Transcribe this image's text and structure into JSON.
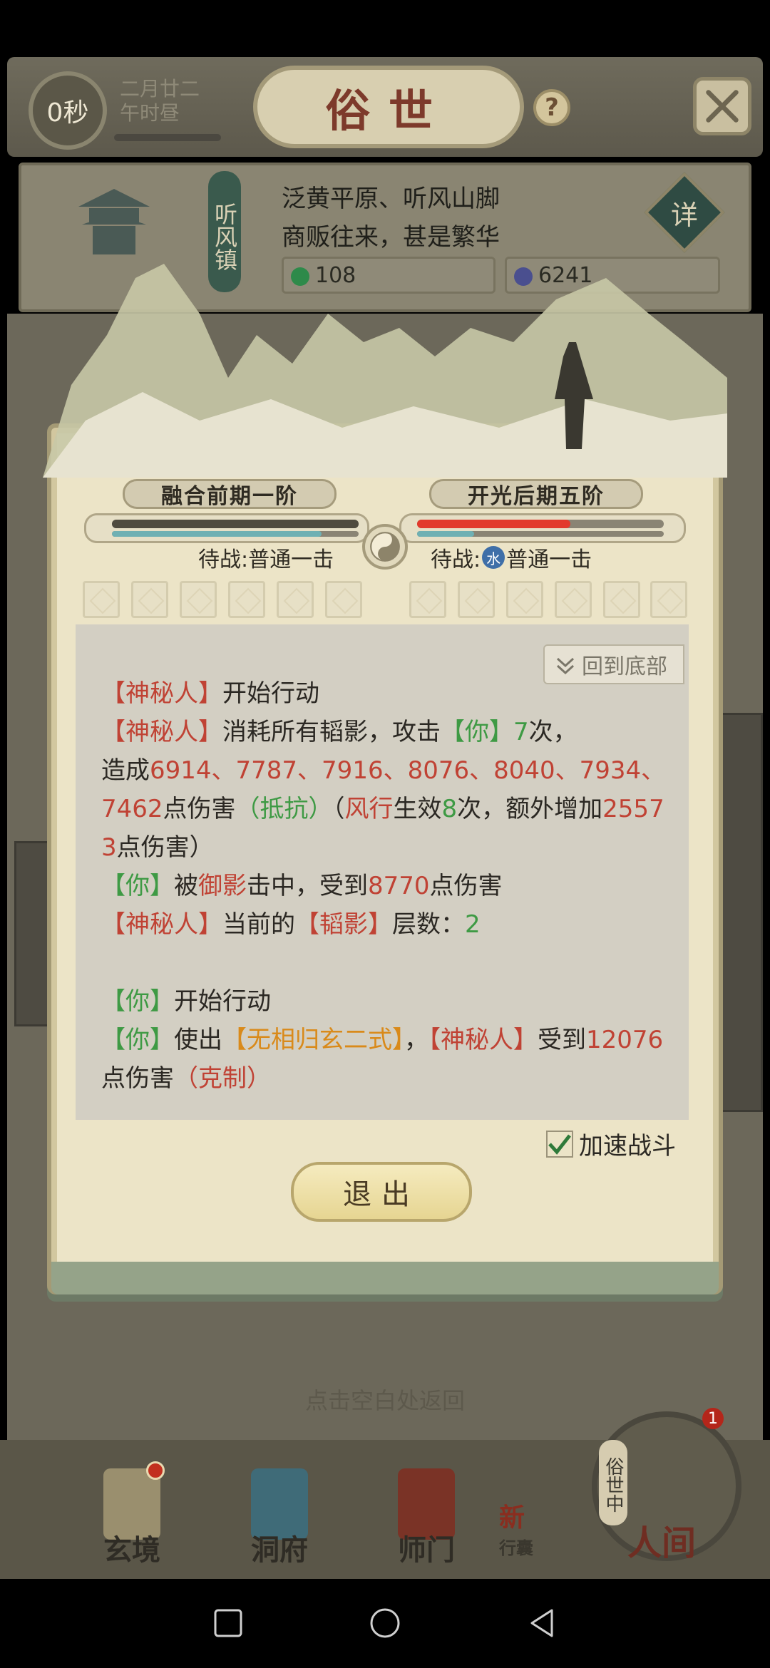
{
  "topbar": {
    "timer": "0秒",
    "date_line1": "二月廿二",
    "date_line2": "午时昼",
    "title": "俗世",
    "help": "?"
  },
  "location": {
    "town": "听风镇",
    "desc_line1": "泛黄平原、听风山脚",
    "desc_line2": "商贩往来，甚是繁华",
    "detail": "详",
    "resource1": "108",
    "resource2": "6241"
  },
  "battle": {
    "left_name": "融合前期一阶",
    "right_name": "开光后期五阶",
    "left_status": "待战:普通一击",
    "right_status_prefix": "待战:",
    "right_element": "水",
    "right_status_suffix": "普通一击",
    "left_hp": 1.0,
    "left_mp": 0.85,
    "right_hp": 0.62,
    "right_mp": 0.23,
    "colors": {
      "hp": "#e23a2c",
      "mp": "#6fb0b3",
      "hp_left": "#4f4b3f",
      "mp_left": "#6fb0b3"
    }
  },
  "log": {
    "back_to_bottom": "回到底部",
    "lines": {
      "l1_a": "【神秘人】",
      "l1_b": "开始行动",
      "l2_a": "【神秘人】",
      "l2_b": "消耗所有韬影，攻击",
      "l2_c": "【你】",
      "l2_d": "7",
      "l2_e": "次，",
      "l3_a": "造成",
      "l3_b": "6914、7787、7916、8076、8040、7934、7462",
      "l3_c": "点伤害",
      "l3_d": "（抵抗）",
      "l3_e": "（",
      "l3_f": "风行",
      "l3_g": "生效",
      "l3_h": "8",
      "l3_i": "次，额外增加",
      "l3_j": "25573",
      "l3_k": "点伤害）",
      "l4_a": "【你】",
      "l4_b": "被",
      "l4_c": "御影",
      "l4_d": "击中，受到",
      "l4_e": "8770",
      "l4_f": "点伤害",
      "l5_a": "【神秘人】",
      "l5_b": "当前的",
      "l5_c": "【韬影】",
      "l5_d": "层数：",
      "l5_e": "2",
      "l6_a": "【你】",
      "l6_b": "开始行动",
      "l7_a": "【你】",
      "l7_b": "使出",
      "l7_c": "【无相归玄二式】",
      "l7_d": "，",
      "l7_e": "【神秘人】",
      "l7_f": "受到",
      "l7_g": "12076",
      "l7_h": "点伤害",
      "l7_i": "（克制）"
    }
  },
  "controls": {
    "speed_label": "加速战斗",
    "speed_checked": true,
    "exit_label": "退出"
  },
  "hint": "点击空白处返回",
  "nav": {
    "items": [
      "玄境",
      "洞府",
      "师门"
    ],
    "new_label": "新",
    "new_sub": "行囊",
    "renjian": "人间",
    "renjian_side": "俗世中",
    "badge": "1"
  }
}
